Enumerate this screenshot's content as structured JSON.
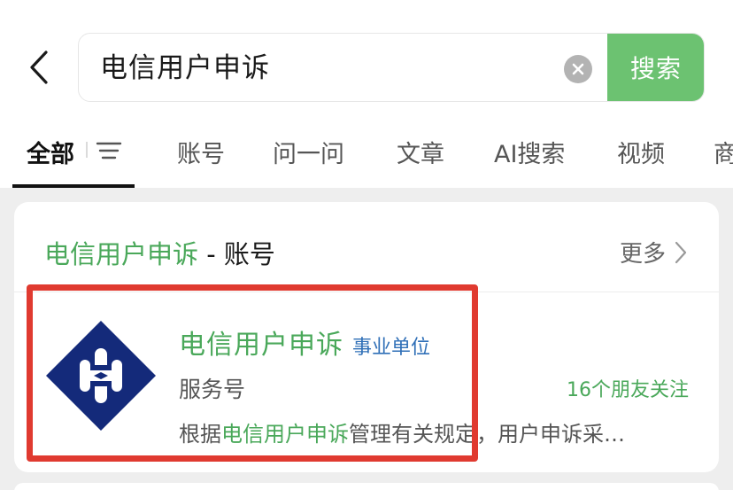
{
  "search": {
    "query": "电信用户申诉",
    "button_label": "搜索"
  },
  "tabs": [
    {
      "label": "全部",
      "active": true
    },
    {
      "label": "账号"
    },
    {
      "label": "问一问"
    },
    {
      "label": "文章"
    },
    {
      "label": "AI搜索"
    },
    {
      "label": "视频"
    },
    {
      "label": "商"
    }
  ],
  "section": {
    "title_query": "电信用户申诉",
    "title_suffix": " - 账号",
    "more_label": "更多"
  },
  "result": {
    "name": "电信用户申诉",
    "badge": "事业单位",
    "type": "服务号",
    "friends": "16个朋友关注",
    "desc_prefix": "根据",
    "desc_highlight": "电信用户申诉",
    "desc_suffix": "管理有关规定，用户申诉采…"
  },
  "colors": {
    "accent_green": "#4aa85a",
    "search_button": "#6cc271",
    "badge_blue": "#2f6fb7",
    "logo_navy": "#142a7a",
    "highlight_red": "#e03a30"
  }
}
